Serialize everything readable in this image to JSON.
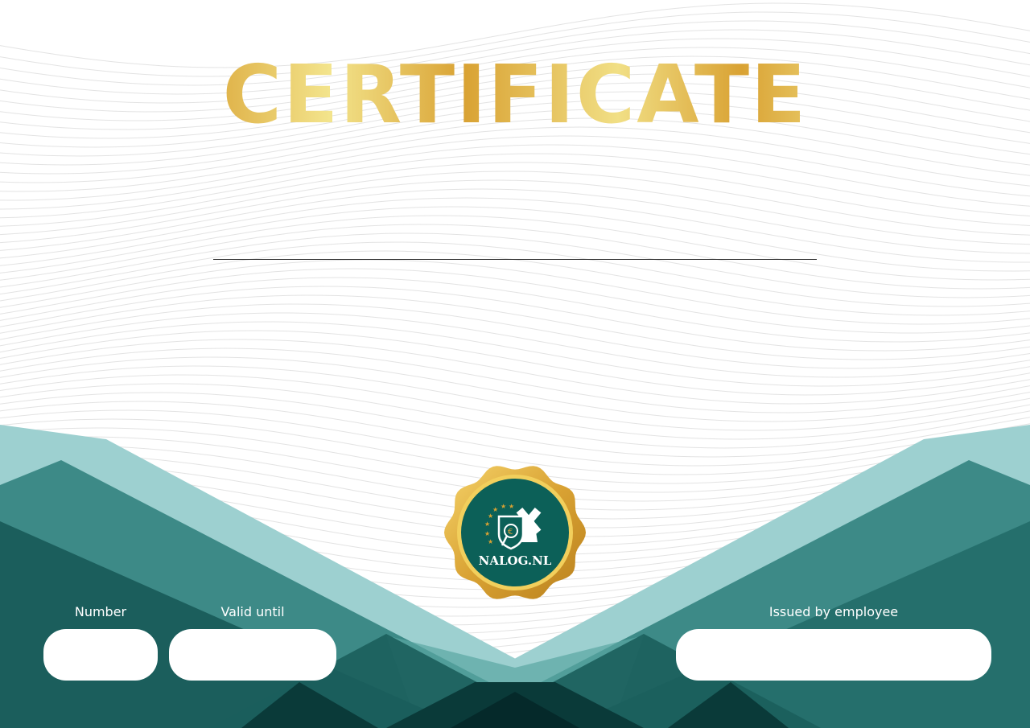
{
  "title": "CERTIFICATE",
  "seal": {
    "brand": "NALOG.NL",
    "icon": "windmill-shield-euro-icon"
  },
  "fields": {
    "number": {
      "label": "Number",
      "value": ""
    },
    "valid_until": {
      "label": "Valid until",
      "value": ""
    },
    "issued_by": {
      "label": "Issued by employee",
      "value": ""
    }
  },
  "colors": {
    "gold": "#d9a233",
    "teal_light": "#9dd0d0",
    "teal_mid": "#3d8a87",
    "teal_dark": "#1b5e5c",
    "teal_darkest": "#0a3a39",
    "seal_green": "#0c6058"
  }
}
